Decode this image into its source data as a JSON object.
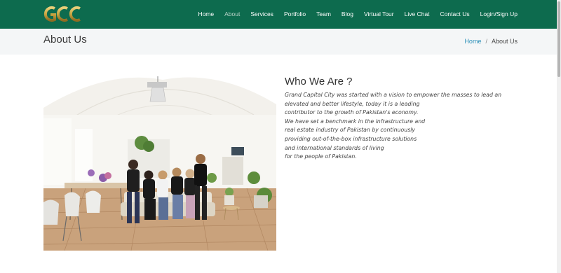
{
  "brand": {
    "logo_text": "GCC",
    "logo_color": "#c9a642"
  },
  "nav": {
    "items": [
      {
        "label": "Home",
        "active": false
      },
      {
        "label": "About",
        "active": true
      },
      {
        "label": "Services",
        "active": false
      },
      {
        "label": "Portfolio",
        "active": false
      },
      {
        "label": "Team",
        "active": false
      },
      {
        "label": "Blog",
        "active": false
      },
      {
        "label": "Virtual Tour",
        "active": false
      },
      {
        "label": "Live Chat",
        "active": false
      },
      {
        "label": "Contact Us",
        "active": false
      },
      {
        "label": "Login/Sign Up",
        "active": false
      }
    ]
  },
  "page_header": {
    "title": "About Us",
    "breadcrumb": {
      "home": "Home",
      "separator": "/",
      "current": "About Us"
    }
  },
  "about": {
    "heading": "Who We Are ?",
    "lines": [
      "Grand Capital City was started with a vision to empower the masses to lead an",
      "elevated and better lifestyle, today it is a leading",
      "contributor to the growth of Pakistan's economy.",
      "We have set a benchmark in the infrastructure and",
      "real estate industry of Pakistan by continuously",
      "providing out-of-the-box infrastructure solutions",
      "and international standards of living",
      "for the people of Pakistan."
    ]
  },
  "colors": {
    "nav_bg": "#0d6b4e",
    "header_bg": "#f4f6f7",
    "link": "#2a8fb8"
  }
}
